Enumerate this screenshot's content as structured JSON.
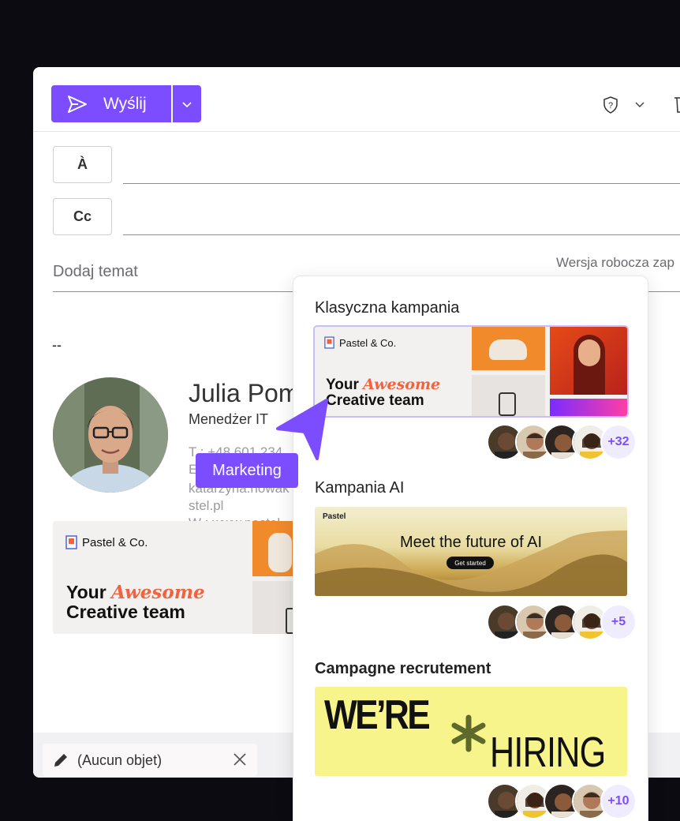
{
  "toolbar": {
    "send_label": "Wyślij"
  },
  "recipients": {
    "to_label": "À",
    "cc_label": "Cc"
  },
  "subject": {
    "placeholder": "Dodaj temat",
    "draft_status": "Wersja robocza zap"
  },
  "signature": {
    "separator": "--",
    "name": "Julia Pom",
    "title": "Menedżer IT",
    "line1": "T : +48 601 234",
    "line2": "E",
    "line3": "katarzyna.nowak",
    "line4": "stel.pl",
    "line5": "W : www.pastel",
    "banner": {
      "brand": "Pastel & Co.",
      "your": "Your",
      "awesome": "Awesome",
      "creative": "Creative team"
    }
  },
  "bottom": {
    "draft_label": "(Aucun objet)"
  },
  "cursor_label": "Marketing",
  "campaigns": [
    {
      "title": "Klasyczna kampania",
      "brand": "Pastel & Co.",
      "your": "Your",
      "awesome": "Awesome",
      "creative": "Creative team",
      "count": "+32"
    },
    {
      "title": "Kampania AI",
      "brand": "Pastel",
      "headline": "Meet the future of AI",
      "cta": "Get started",
      "count": "+5"
    },
    {
      "title": "Campagne recrutement",
      "were": "WE’RE",
      "hiring": "HIRING",
      "count": "+10"
    }
  ],
  "colors": {
    "accent": "#7b4dff",
    "awesome": "#f2623f",
    "hiring_bg": "#f6f48a"
  }
}
